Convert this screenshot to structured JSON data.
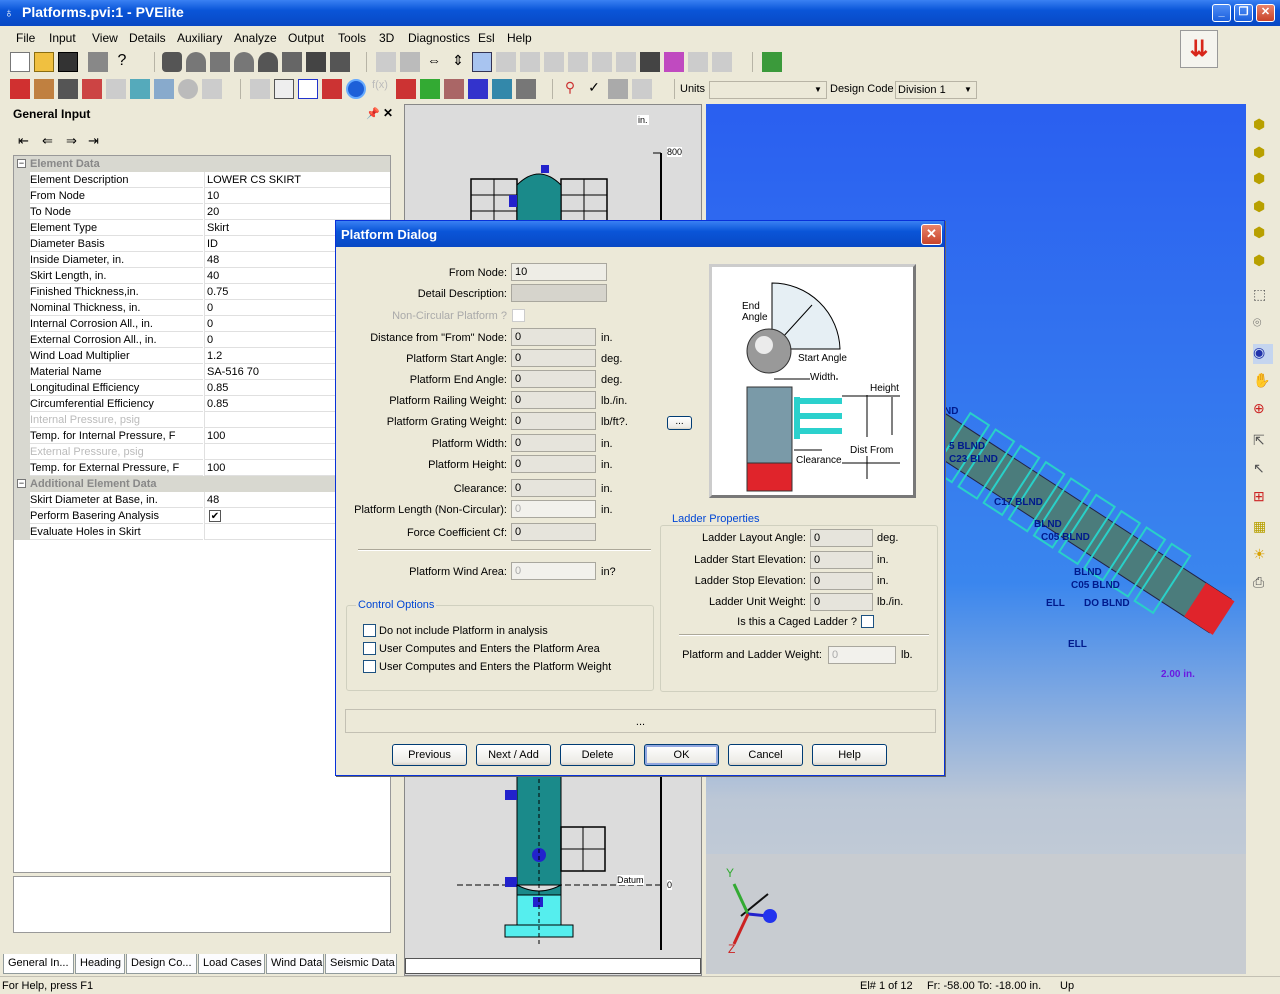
{
  "app": {
    "title": "Platforms.pvi:1 - PVElite"
  },
  "menu": [
    "File",
    "Input",
    "View",
    "Details",
    "Auxiliary",
    "Analyze",
    "Output",
    "Tools",
    "3D",
    "Diagnostics",
    "Esl",
    "Help"
  ],
  "toolbar": {
    "units_label": "Units",
    "units_value": "",
    "design_code_label": "Design Code",
    "design_code_value": "Division 1"
  },
  "panel": {
    "title": "General Input",
    "categories": {
      "element_data": "Element Data",
      "additional_element_data": "Additional Element Data"
    },
    "rows": [
      {
        "k": "Element Description",
        "v": "LOWER CS SKIRT"
      },
      {
        "k": "From Node",
        "v": "10"
      },
      {
        "k": "To Node",
        "v": "20"
      },
      {
        "k": "Element Type",
        "v": "Skirt"
      },
      {
        "k": "Diameter Basis",
        "v": "ID"
      },
      {
        "k": "Inside Diameter, in.",
        "v": "48"
      },
      {
        "k": "Skirt Length, in.",
        "v": "40"
      },
      {
        "k": "Finished Thickness,in.",
        "v": "0.75"
      },
      {
        "k": "Nominal Thickness, in.",
        "v": "0"
      },
      {
        "k": "Internal Corrosion All., in.",
        "v": "0"
      },
      {
        "k": "External Corrosion All., in.",
        "v": "0"
      },
      {
        "k": "Wind Load Multiplier",
        "v": "1.2"
      },
      {
        "k": "Material Name",
        "v": "SA-516 70"
      },
      {
        "k": "Longitudinal Efficiency",
        "v": "0.85"
      },
      {
        "k": "Circumferential Efficiency",
        "v": "0.85"
      },
      {
        "k": "Internal Pressure, psig",
        "v": ""
      },
      {
        "k": "Temp. for Internal Pressure, F",
        "v": "100"
      },
      {
        "k": "External Pressure, psig",
        "v": ""
      },
      {
        "k": "Temp. for External Pressure, F",
        "v": "100"
      }
    ],
    "extra_rows": [
      {
        "k": "Skirt Diameter at Base, in.",
        "v": "48"
      },
      {
        "k": "Perform Basering Analysis",
        "v": "✔"
      },
      {
        "k": "Evaluate Holes in Skirt",
        "v": ""
      }
    ],
    "tabs": [
      "General In...",
      "Heading",
      "Design Co...",
      "Load Cases",
      "Wind Data",
      "Seismic Data"
    ]
  },
  "drawing": {
    "scale_top": "800",
    "scale_bottom": "0",
    "unit_label": "in.",
    "datum_label": "Datum"
  },
  "view3d": {
    "labels": [
      "ND",
      "5 BLND",
      "C23 BLND",
      "C17 BLND",
      "BLND",
      "C05 BLND",
      "BLND",
      "C05 BLND",
      "DO BLND",
      "ELL",
      "ELL",
      "2.00 in."
    ],
    "axis_y": "Y",
    "axis_z": "Z"
  },
  "dialog": {
    "title": "Platform Dialog",
    "from_node_label": "From Node:",
    "from_node": "10",
    "detail_desc_label": "Detail Description:",
    "detail_desc": "",
    "noncircular_label": "Non-Circular Platform ?",
    "fields": [
      {
        "label": "Distance from \"From\" Node:",
        "value": "0",
        "unit": "in."
      },
      {
        "label": "Platform Start Angle:",
        "value": "0",
        "unit": "deg."
      },
      {
        "label": "Platform End Angle:",
        "value": "0",
        "unit": "deg."
      },
      {
        "label": "Platform Railing Weight:",
        "value": "0",
        "unit": "lb./in."
      },
      {
        "label": "Platform Grating Weight:",
        "value": "0",
        "unit": "lb/ft?."
      },
      {
        "label": "Platform Width:",
        "value": "0",
        "unit": "in."
      },
      {
        "label": "Platform Height:",
        "value": "0",
        "unit": "in."
      },
      {
        "label": "Clearance:",
        "value": "0",
        "unit": "in."
      },
      {
        "label": "Platform Length (Non-Circular):",
        "value": "0",
        "unit": "in."
      },
      {
        "label": "Force Coefficient Cf:",
        "value": "0",
        "unit": ""
      }
    ],
    "ellipsis_btn": "...",
    "wind_area_label": "Platform Wind Area:",
    "wind_area": "0",
    "wind_area_unit": "in?",
    "control_options_title": "Control Options",
    "options": [
      "Do not include Platform in analysis",
      "User Computes and Enters the Platform Area",
      "User Computes and Enters the Platform Weight"
    ],
    "ladder_title": "Ladder Properties",
    "ladder_fields": [
      {
        "label": "Ladder Layout Angle:",
        "value": "0",
        "unit": "deg."
      },
      {
        "label": "Ladder Start Elevation:",
        "value": "0",
        "unit": "in."
      },
      {
        "label": "Ladder Stop Elevation:",
        "value": "0",
        "unit": "in."
      },
      {
        "label": "Ladder Unit Weight:",
        "value": "0",
        "unit": "lb./in."
      }
    ],
    "caged_label": "Is this a Caged Ladder ?",
    "pl_weight_label": "Platform and Ladder Weight:",
    "pl_weight": "0",
    "pl_weight_unit": "lb.",
    "status_text": "...",
    "img_labels": {
      "end_angle": "End Angle",
      "start_angle": "Start Angle",
      "width": "Width",
      "height": "Height",
      "clearance": "Clearance",
      "dist_from": "Dist From"
    },
    "buttons": {
      "previous": "Previous",
      "next": "Next / Add",
      "delete": "Delete",
      "ok": "OK",
      "cancel": "Cancel",
      "help": "Help"
    }
  },
  "status": {
    "help": "For Help, press F1",
    "elem": "El# 1 of 12",
    "range": "Fr: -58.00 To: -18.00 in.",
    "dir": "Up"
  }
}
